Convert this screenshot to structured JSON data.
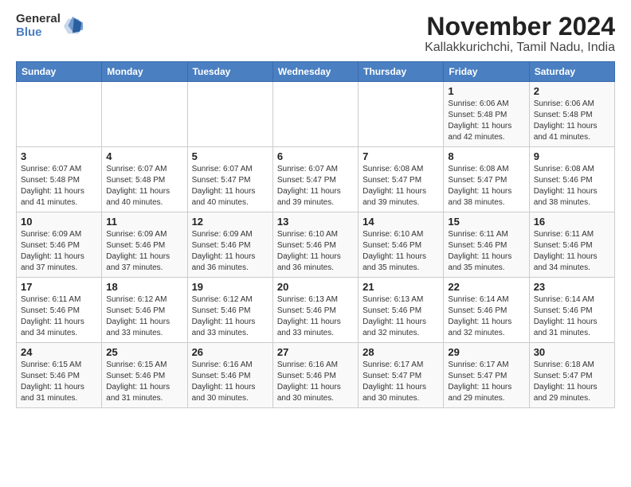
{
  "logo": {
    "general": "General",
    "blue": "Blue"
  },
  "header": {
    "month": "November 2024",
    "location": "Kallakkurichchi, Tamil Nadu, India"
  },
  "days_of_week": [
    "Sunday",
    "Monday",
    "Tuesday",
    "Wednesday",
    "Thursday",
    "Friday",
    "Saturday"
  ],
  "weeks": [
    [
      {
        "day": "",
        "info": ""
      },
      {
        "day": "",
        "info": ""
      },
      {
        "day": "",
        "info": ""
      },
      {
        "day": "",
        "info": ""
      },
      {
        "day": "",
        "info": ""
      },
      {
        "day": "1",
        "info": "Sunrise: 6:06 AM\nSunset: 5:48 PM\nDaylight: 11 hours and 42 minutes."
      },
      {
        "day": "2",
        "info": "Sunrise: 6:06 AM\nSunset: 5:48 PM\nDaylight: 11 hours and 41 minutes."
      }
    ],
    [
      {
        "day": "3",
        "info": "Sunrise: 6:07 AM\nSunset: 5:48 PM\nDaylight: 11 hours and 41 minutes."
      },
      {
        "day": "4",
        "info": "Sunrise: 6:07 AM\nSunset: 5:48 PM\nDaylight: 11 hours and 40 minutes."
      },
      {
        "day": "5",
        "info": "Sunrise: 6:07 AM\nSunset: 5:47 PM\nDaylight: 11 hours and 40 minutes."
      },
      {
        "day": "6",
        "info": "Sunrise: 6:07 AM\nSunset: 5:47 PM\nDaylight: 11 hours and 39 minutes."
      },
      {
        "day": "7",
        "info": "Sunrise: 6:08 AM\nSunset: 5:47 PM\nDaylight: 11 hours and 39 minutes."
      },
      {
        "day": "8",
        "info": "Sunrise: 6:08 AM\nSunset: 5:47 PM\nDaylight: 11 hours and 38 minutes."
      },
      {
        "day": "9",
        "info": "Sunrise: 6:08 AM\nSunset: 5:46 PM\nDaylight: 11 hours and 38 minutes."
      }
    ],
    [
      {
        "day": "10",
        "info": "Sunrise: 6:09 AM\nSunset: 5:46 PM\nDaylight: 11 hours and 37 minutes."
      },
      {
        "day": "11",
        "info": "Sunrise: 6:09 AM\nSunset: 5:46 PM\nDaylight: 11 hours and 37 minutes."
      },
      {
        "day": "12",
        "info": "Sunrise: 6:09 AM\nSunset: 5:46 PM\nDaylight: 11 hours and 36 minutes."
      },
      {
        "day": "13",
        "info": "Sunrise: 6:10 AM\nSunset: 5:46 PM\nDaylight: 11 hours and 36 minutes."
      },
      {
        "day": "14",
        "info": "Sunrise: 6:10 AM\nSunset: 5:46 PM\nDaylight: 11 hours and 35 minutes."
      },
      {
        "day": "15",
        "info": "Sunrise: 6:11 AM\nSunset: 5:46 PM\nDaylight: 11 hours and 35 minutes."
      },
      {
        "day": "16",
        "info": "Sunrise: 6:11 AM\nSunset: 5:46 PM\nDaylight: 11 hours and 34 minutes."
      }
    ],
    [
      {
        "day": "17",
        "info": "Sunrise: 6:11 AM\nSunset: 5:46 PM\nDaylight: 11 hours and 34 minutes."
      },
      {
        "day": "18",
        "info": "Sunrise: 6:12 AM\nSunset: 5:46 PM\nDaylight: 11 hours and 33 minutes."
      },
      {
        "day": "19",
        "info": "Sunrise: 6:12 AM\nSunset: 5:46 PM\nDaylight: 11 hours and 33 minutes."
      },
      {
        "day": "20",
        "info": "Sunrise: 6:13 AM\nSunset: 5:46 PM\nDaylight: 11 hours and 33 minutes."
      },
      {
        "day": "21",
        "info": "Sunrise: 6:13 AM\nSunset: 5:46 PM\nDaylight: 11 hours and 32 minutes."
      },
      {
        "day": "22",
        "info": "Sunrise: 6:14 AM\nSunset: 5:46 PM\nDaylight: 11 hours and 32 minutes."
      },
      {
        "day": "23",
        "info": "Sunrise: 6:14 AM\nSunset: 5:46 PM\nDaylight: 11 hours and 31 minutes."
      }
    ],
    [
      {
        "day": "24",
        "info": "Sunrise: 6:15 AM\nSunset: 5:46 PM\nDaylight: 11 hours and 31 minutes."
      },
      {
        "day": "25",
        "info": "Sunrise: 6:15 AM\nSunset: 5:46 PM\nDaylight: 11 hours and 31 minutes."
      },
      {
        "day": "26",
        "info": "Sunrise: 6:16 AM\nSunset: 5:46 PM\nDaylight: 11 hours and 30 minutes."
      },
      {
        "day": "27",
        "info": "Sunrise: 6:16 AM\nSunset: 5:46 PM\nDaylight: 11 hours and 30 minutes."
      },
      {
        "day": "28",
        "info": "Sunrise: 6:17 AM\nSunset: 5:47 PM\nDaylight: 11 hours and 30 minutes."
      },
      {
        "day": "29",
        "info": "Sunrise: 6:17 AM\nSunset: 5:47 PM\nDaylight: 11 hours and 29 minutes."
      },
      {
        "day": "30",
        "info": "Sunrise: 6:18 AM\nSunset: 5:47 PM\nDaylight: 11 hours and 29 minutes."
      }
    ]
  ]
}
